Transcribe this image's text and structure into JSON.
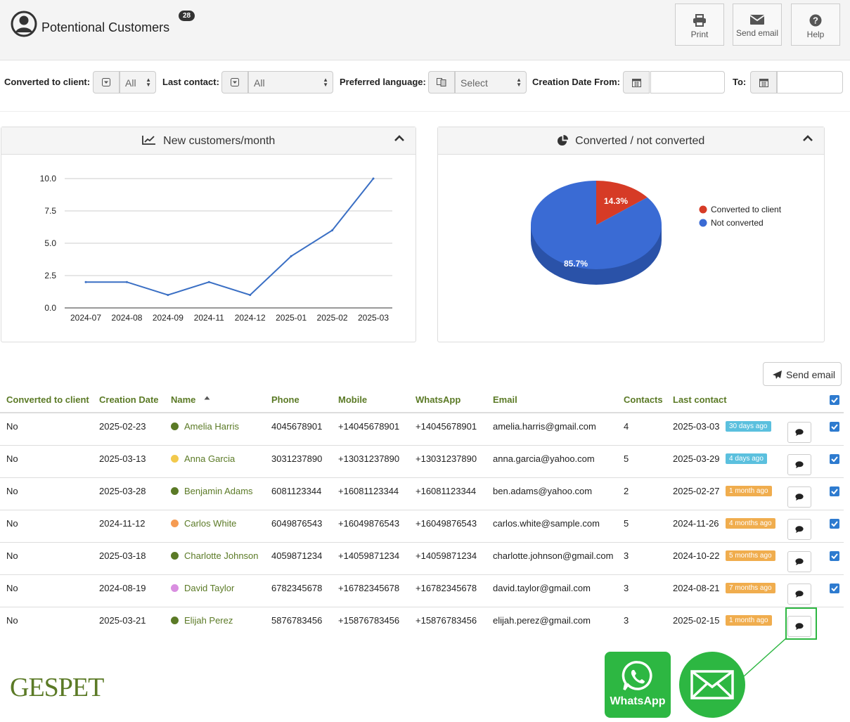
{
  "header": {
    "title": "Potentional Customers",
    "badge": "28",
    "buttons": [
      {
        "label": "Print",
        "icon": "printer-icon"
      },
      {
        "label": "Send email",
        "icon": "envelope-icon"
      },
      {
        "label": "Help",
        "icon": "help-icon"
      }
    ]
  },
  "filters": {
    "converted_label": "Converted to client:",
    "converted_value": "All",
    "last_contact_label": "Last contact:",
    "last_contact_value": "All",
    "language_label": "Preferred language:",
    "language_value": "Select",
    "date_from_label": "Creation Date From:",
    "date_to_label": "To:"
  },
  "line_panel": {
    "title": "New customers/month"
  },
  "pie_panel": {
    "title": "Converted / not converted"
  },
  "chart_data": [
    {
      "type": "line",
      "title": "New customers/month",
      "categories": [
        "2024-07",
        "2024-08",
        "2024-09",
        "2024-11",
        "2024-12",
        "2025-01",
        "2025-02",
        "2025-03"
      ],
      "values": [
        2,
        2,
        1,
        2,
        1,
        4,
        6,
        10
      ],
      "ylim": [
        0,
        10
      ],
      "yticks": [
        "0.0",
        "2.5",
        "5.0",
        "7.5",
        "10.0"
      ],
      "grid": true,
      "color": "#3a6fc4"
    },
    {
      "type": "pie",
      "title": "Converted / not converted",
      "labels": [
        "Converted to client",
        "Not converted"
      ],
      "values": [
        14.3,
        85.7
      ],
      "value_labels": [
        "14.3%",
        "85.7%"
      ],
      "colors": [
        "#d63b26",
        "#3a6bd4"
      ],
      "legend": "right"
    }
  ],
  "table": {
    "send_email_label": "Send email",
    "columns": [
      "Converted to client",
      "Creation Date",
      "Name",
      "Phone",
      "Mobile",
      "WhatsApp",
      "Email",
      "Contacts",
      "Last contact"
    ],
    "rows": [
      {
        "converted": "No",
        "created": "2025-02-23",
        "name": "Amelia Harris",
        "dot": "#5b7a26",
        "phone": "4045678901",
        "mobile": "+14045678901",
        "whatsapp": "+14045678901",
        "email": "amelia.harris@gmail.com",
        "contacts": "4",
        "last": "2025-03-03",
        "ago": "30 days ago",
        "ago_color": "blue",
        "checked": true
      },
      {
        "converted": "No",
        "created": "2025-03-13",
        "name": "Anna Garcia",
        "dot": "#f2c94c",
        "phone": "3031237890",
        "mobile": "+13031237890",
        "whatsapp": "+13031237890",
        "email": "anna.garcia@yahoo.com",
        "contacts": "5",
        "last": "2025-03-29",
        "ago": "4 days ago",
        "ago_color": "blue",
        "checked": true
      },
      {
        "converted": "No",
        "created": "2025-03-28",
        "name": "Benjamin Adams",
        "dot": "#5b7a26",
        "phone": "6081123344",
        "mobile": "+16081123344",
        "whatsapp": "+16081123344",
        "email": "ben.adams@yahoo.com",
        "contacts": "2",
        "last": "2025-02-27",
        "ago": "1 month ago",
        "ago_color": "orange",
        "checked": true
      },
      {
        "converted": "No",
        "created": "2024-11-12",
        "name": "Carlos White",
        "dot": "#f59b52",
        "phone": "6049876543",
        "mobile": "+16049876543",
        "whatsapp": "+16049876543",
        "email": "carlos.white@sample.com",
        "contacts": "5",
        "last": "2024-11-26",
        "ago": "4 months ago",
        "ago_color": "orange",
        "checked": true
      },
      {
        "converted": "No",
        "created": "2025-03-18",
        "name": "Charlotte Johnson",
        "dot": "#5b7a26",
        "phone": "4059871234",
        "mobile": "+14059871234",
        "whatsapp": "+14059871234",
        "email": "charlotte.johnson@gmail.com",
        "contacts": "3",
        "last": "2024-10-22",
        "ago": "5 months ago",
        "ago_color": "orange",
        "checked": true
      },
      {
        "converted": "No",
        "created": "2024-08-19",
        "name": "David Taylor",
        "dot": "#d98ee0",
        "phone": "6782345678",
        "mobile": "+16782345678",
        "whatsapp": "+16782345678",
        "email": "david.taylor@gmail.com",
        "contacts": "3",
        "last": "2024-08-21",
        "ago": "7 months ago",
        "ago_color": "orange",
        "checked": true
      },
      {
        "converted": "No",
        "created": "2025-03-21",
        "name": "Elijah Perez",
        "dot": "#5b7a26",
        "phone": "5876783456",
        "mobile": "+15876783456",
        "whatsapp": "+15876783456",
        "email": "elijah.perez@gmail.com",
        "contacts": "3",
        "last": "2025-02-15",
        "ago": "1 month ago",
        "ago_color": "orange",
        "checked": false
      }
    ]
  },
  "footer": {
    "logo": "GESPET",
    "whatsapp_label": "WhatsApp"
  },
  "colors": {
    "accent_green": "#5b7a26",
    "whatsapp_green": "#2db742",
    "checkbox_blue": "#2e7bcf"
  }
}
